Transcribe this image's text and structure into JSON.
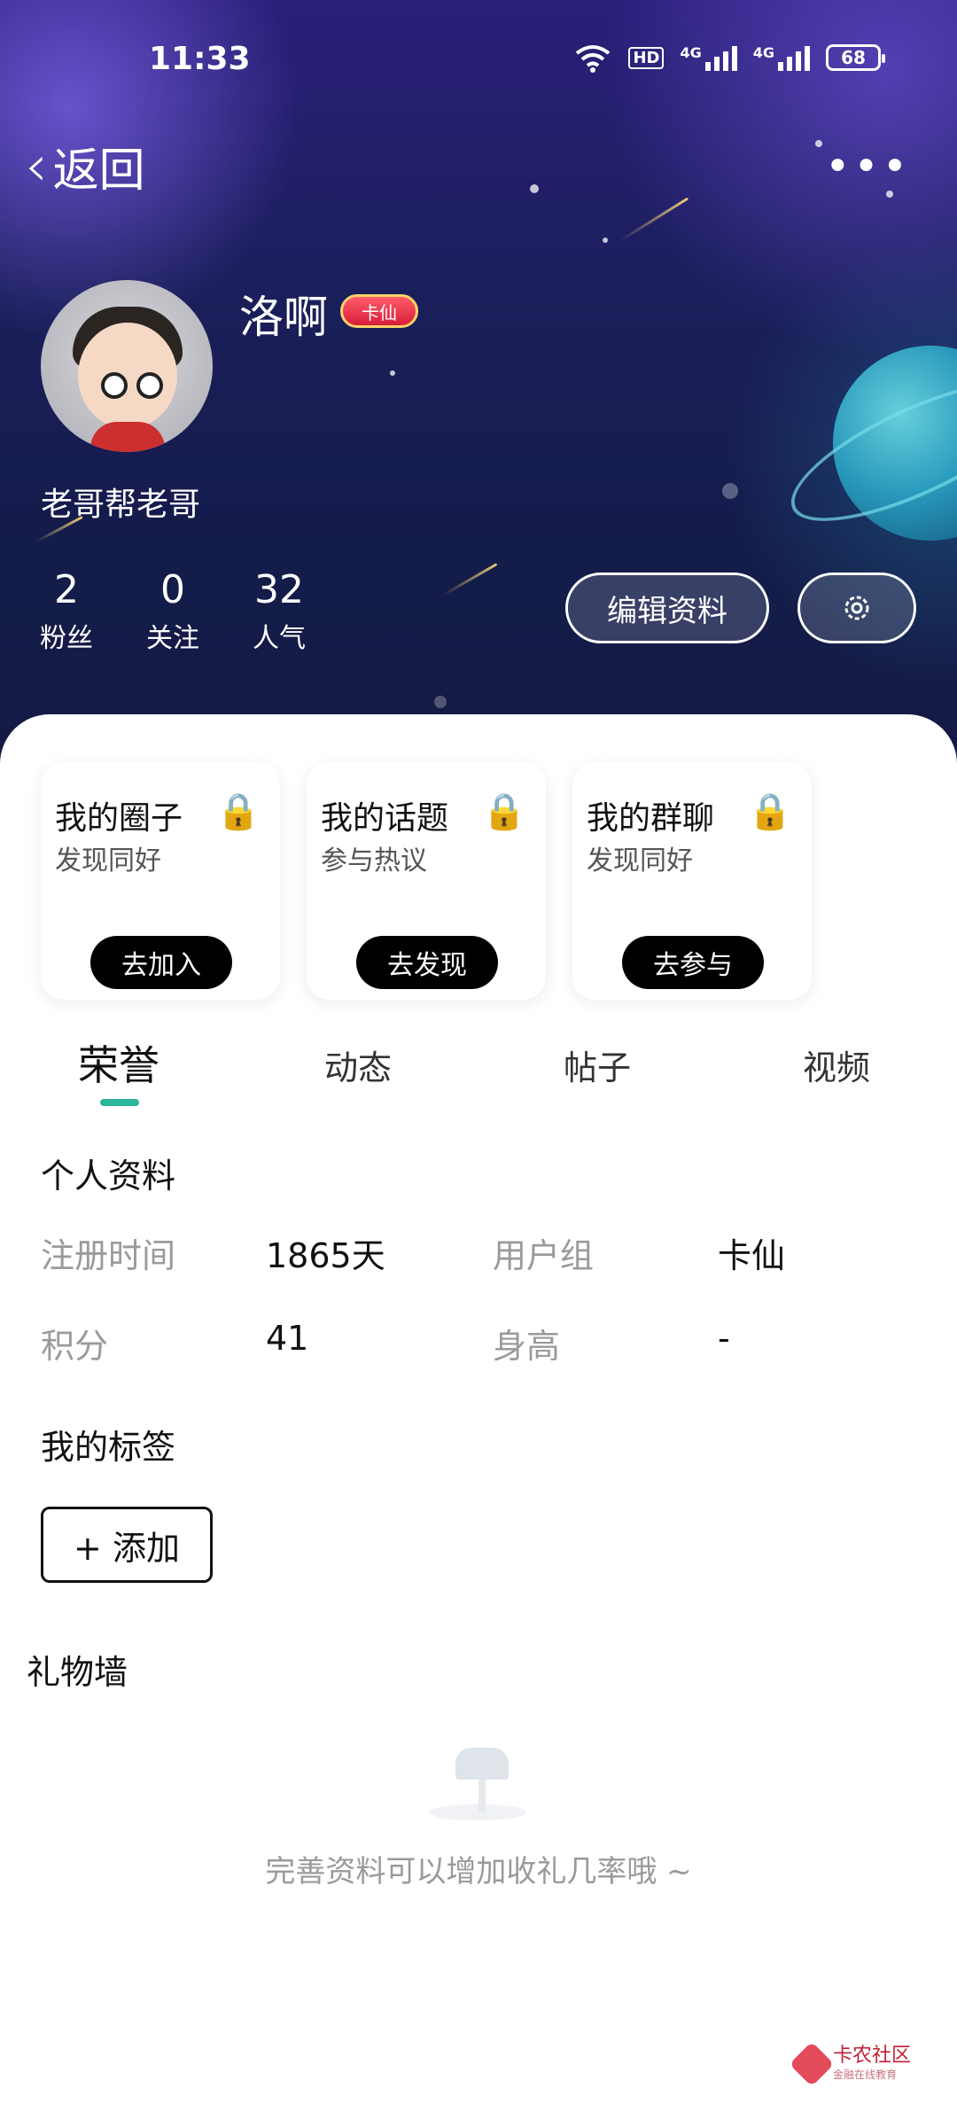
{
  "status_bar": {
    "time": "11:33",
    "network_labels": [
      "HD",
      "4G",
      "4G"
    ],
    "battery": "68"
  },
  "nav": {
    "back_label": "返回",
    "more_label": "•••"
  },
  "profile": {
    "username": "洛啊",
    "badge_label": "卡仙",
    "bio": "老哥帮老哥",
    "stats": [
      {
        "value": "2",
        "label": "粉丝"
      },
      {
        "value": "0",
        "label": "关注"
      },
      {
        "value": "32",
        "label": "人气"
      }
    ],
    "edit_button": "编辑资料"
  },
  "cards": [
    {
      "title": "我的圈子",
      "subtitle": "发现同好",
      "cta": "去加入"
    },
    {
      "title": "我的话题",
      "subtitle": "参与热议",
      "cta": "去发现"
    },
    {
      "title": "我的群聊",
      "subtitle": "发现同好",
      "cta": "去参与"
    }
  ],
  "tabs": [
    {
      "label": "荣誉",
      "active": true
    },
    {
      "label": "动态",
      "active": false
    },
    {
      "label": "帖子",
      "active": false
    },
    {
      "label": "视频",
      "active": false
    }
  ],
  "personal_info": {
    "title": "个人资料",
    "fields": [
      {
        "label": "注册时间",
        "value": "1865天"
      },
      {
        "label": "用户组",
        "value": "卡仙"
      },
      {
        "label": "积分",
        "value": "41"
      },
      {
        "label": "身高",
        "value": "-"
      }
    ]
  },
  "tags": {
    "title": "我的标签",
    "add_label": "+ 添加"
  },
  "gift_wall": {
    "title": "礼物墙",
    "empty_text": "完善资料可以增加收礼几率哦 ~"
  },
  "watermark": {
    "name": "卡农社区",
    "tagline": "金融在线教育"
  },
  "colors": {
    "accent": "#2bb59a",
    "header_dark": "#151a43"
  }
}
